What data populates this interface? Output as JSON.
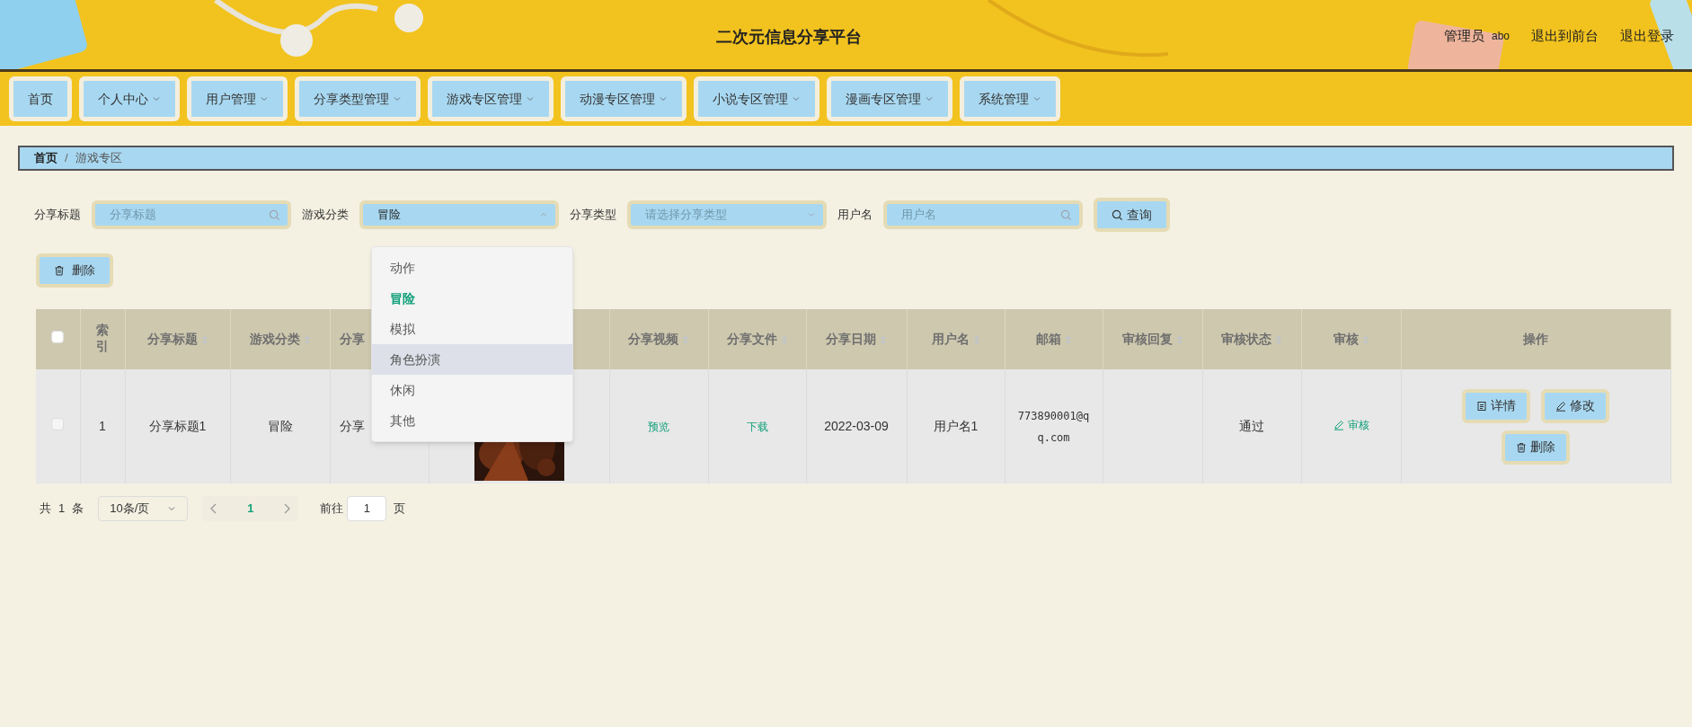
{
  "header": {
    "title": "二次元信息分享平台",
    "user_role": "管理员",
    "user_name": "abo",
    "links": [
      "退出到前台",
      "退出登录"
    ]
  },
  "nav": [
    {
      "label": "首页",
      "has_menu": false
    },
    {
      "label": "个人中心",
      "has_menu": true
    },
    {
      "label": "用户管理",
      "has_menu": true
    },
    {
      "label": "分享类型管理",
      "has_menu": true
    },
    {
      "label": "游戏专区管理",
      "has_menu": true
    },
    {
      "label": "动漫专区管理",
      "has_menu": true
    },
    {
      "label": "小说专区管理",
      "has_menu": true
    },
    {
      "label": "漫画专区管理",
      "has_menu": true
    },
    {
      "label": "系统管理",
      "has_menu": true
    }
  ],
  "breadcrumb": [
    "首页",
    "游戏专区"
  ],
  "breadcrumb_separator": "/",
  "filters": [
    {
      "kind": "search",
      "label": "分享标题",
      "placeholder": "分享标题"
    },
    {
      "kind": "select",
      "label": "游戏分类",
      "value": "冒险",
      "open": true
    },
    {
      "kind": "select",
      "label": "分享类型",
      "placeholder": "请选择分享类型",
      "open": false
    },
    {
      "kind": "search",
      "label": "用户名",
      "placeholder": "用户名"
    }
  ],
  "query_button": "查询",
  "delete_button": "删除",
  "dropdown": {
    "options": [
      {
        "label": "动作",
        "selected": false,
        "hovered": false
      },
      {
        "label": "冒险",
        "selected": true,
        "hovered": false
      },
      {
        "label": "模拟",
        "selected": false,
        "hovered": false
      },
      {
        "label": "角色扮演",
        "selected": false,
        "hovered": true
      },
      {
        "label": "休闲",
        "selected": false,
        "hovered": false
      },
      {
        "label": "其他",
        "selected": false,
        "hovered": false
      }
    ]
  },
  "table": {
    "header_checked": false,
    "columns": [
      {
        "kind": "check"
      },
      {
        "kind": "text",
        "label": "索引",
        "sortable": false
      },
      {
        "kind": "text",
        "label": "分享标题",
        "sortable": true
      },
      {
        "kind": "text",
        "label": "游戏分类",
        "sortable": true
      },
      {
        "kind": "text",
        "label": "分享",
        "sortable": false
      },
      {
        "kind": "hidden"
      },
      {
        "kind": "text",
        "label": "分享视频",
        "sortable": true
      },
      {
        "kind": "text",
        "label": "分享文件",
        "sortable": true
      },
      {
        "kind": "text",
        "label": "分享日期",
        "sortable": true
      },
      {
        "kind": "text",
        "label": "用户名",
        "sortable": true
      },
      {
        "kind": "text",
        "label": "邮箱",
        "sortable": true
      },
      {
        "kind": "text",
        "label": "审核回复",
        "sortable": true
      },
      {
        "kind": "text",
        "label": "审核状态",
        "sortable": true
      },
      {
        "kind": "text",
        "label": "审核",
        "sortable": true
      },
      {
        "kind": "text",
        "label": "操作",
        "sortable": false
      }
    ],
    "rows": [
      {
        "checked": false,
        "cells": [
          {
            "kind": "check"
          },
          {
            "kind": "text",
            "text": "1"
          },
          {
            "kind": "text",
            "text": "分享标题1"
          },
          {
            "kind": "text",
            "text": "冒险"
          },
          {
            "kind": "text",
            "text": "分享"
          },
          {
            "kind": "picture"
          },
          {
            "kind": "link",
            "text": "预览"
          },
          {
            "kind": "link",
            "text": "下载"
          },
          {
            "kind": "text",
            "text": "2022-03-09"
          },
          {
            "kind": "text",
            "text": "用户名1"
          },
          {
            "kind": "mono",
            "text": "773890001@qq.com"
          },
          {
            "kind": "empty"
          },
          {
            "kind": "text",
            "text": "通过"
          },
          {
            "kind": "audit",
            "text": "审核"
          },
          {
            "kind": "actions",
            "buttons": [
              "详情",
              "修改",
              "删除"
            ]
          }
        ]
      }
    ]
  },
  "pagination": {
    "total_prefix": "共",
    "total": "1",
    "total_suffix": "条",
    "page_size": "10条/页",
    "pages": [
      {
        "label": "1",
        "selected": true
      }
    ],
    "goto_label": "前往",
    "goto_value": "1",
    "goto_suffix": "页"
  }
}
